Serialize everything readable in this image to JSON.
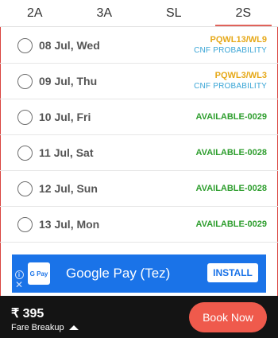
{
  "colors": {
    "tab_underline": "#e0625a",
    "waitlist": "#e6a817",
    "cnf": "#3aa5d6",
    "available": "#2e9e2e",
    "ad_background": "#1a73e8",
    "footer_background": "#141414",
    "book_button": "#ef5a4c"
  },
  "tabs": [
    {
      "label": "2A",
      "active": false
    },
    {
      "label": "3A",
      "active": false
    },
    {
      "label": "SL",
      "active": false
    },
    {
      "label": "2S",
      "active": true
    }
  ],
  "dates": [
    {
      "date": "08 Jul, Wed",
      "status": "PQWL13/WL9",
      "sub": "CNF PROBABILITY",
      "status_color": "#e6a817"
    },
    {
      "date": "09 Jul, Thu",
      "status": "PQWL3/WL3",
      "sub": "CNF PROBABILITY",
      "status_color": "#e6a817"
    },
    {
      "date": "10 Jul, Fri",
      "status": "AVAILABLE-0029",
      "sub": "",
      "status_color": "#2e9e2e"
    },
    {
      "date": "11 Jul, Sat",
      "status": "AVAILABLE-0028",
      "sub": "",
      "status_color": "#2e9e2e"
    },
    {
      "date": "12 Jul, Sun",
      "status": "AVAILABLE-0028",
      "sub": "",
      "status_color": "#2e9e2e"
    },
    {
      "date": "13 Jul, Mon",
      "status": "AVAILABLE-0029",
      "sub": "",
      "status_color": "#2e9e2e"
    }
  ],
  "ad": {
    "logo_text": "G Pay",
    "title": "Google Pay (Tez)",
    "install_label": "INSTALL",
    "info_icon": "info-icon",
    "close_icon": "close-icon"
  },
  "footer": {
    "fare": "₹ 395",
    "breakup_label": "Fare Breakup",
    "book_label": "Book Now"
  }
}
